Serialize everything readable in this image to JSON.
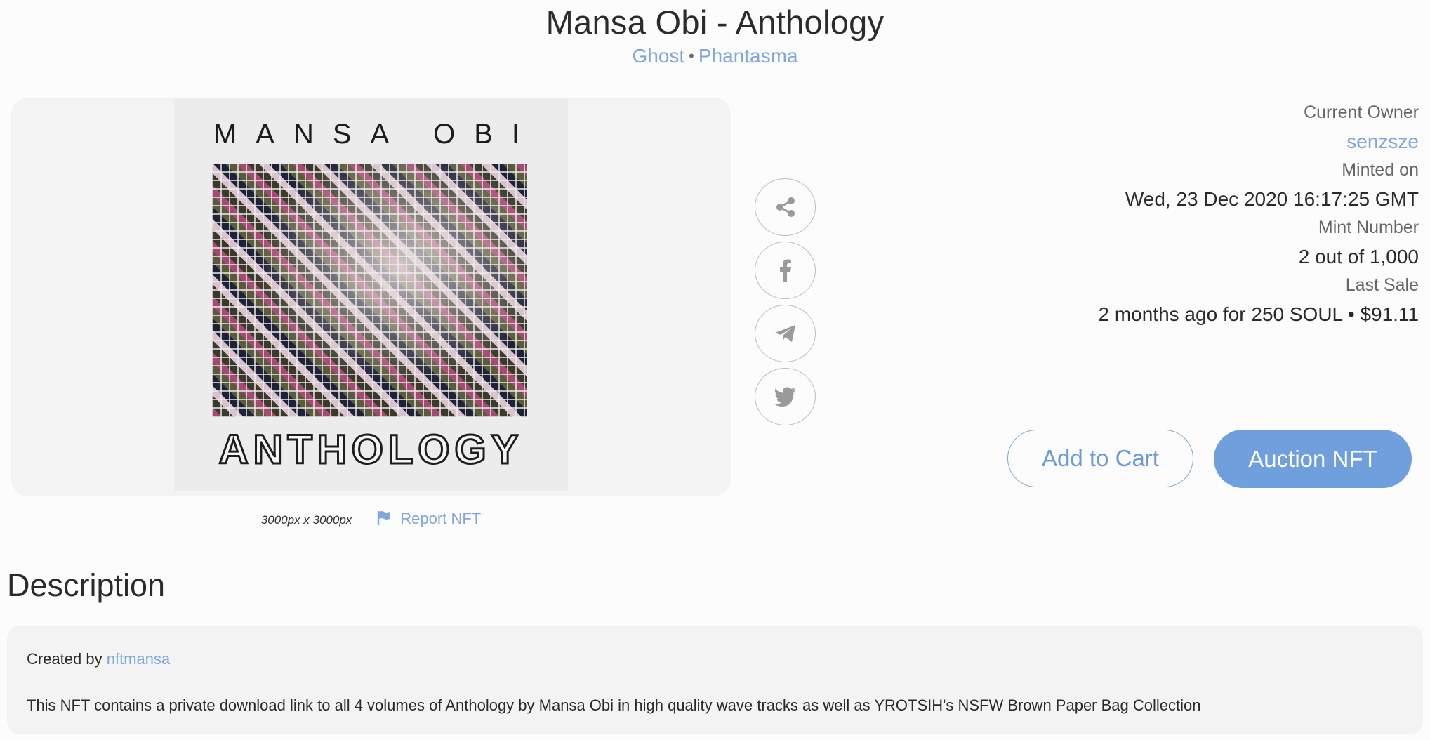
{
  "header": {
    "title": "Mansa Obi - Anthology",
    "links": [
      "Ghost",
      "Phantasma"
    ],
    "separator": "•"
  },
  "artwork": {
    "top_text": "MANSA OBI",
    "bottom_text": "ANTHOLOGY",
    "dimensions": "3000px x 3000px",
    "report_label": "Report NFT"
  },
  "share": {
    "icons": [
      "share-icon",
      "facebook-icon",
      "telegram-icon",
      "twitter-icon"
    ]
  },
  "info": {
    "owner_label": "Current Owner",
    "owner_value": "senzsze",
    "minted_label": "Minted on",
    "minted_value": "Wed, 23 Dec 2020 16:17:25 GMT",
    "mint_number_label": "Mint Number",
    "mint_number_value": "2 out of 1,000",
    "last_sale_label": "Last Sale",
    "last_sale_value": "2 months ago for 250 SOUL • $91.11"
  },
  "actions": {
    "add_to_cart": "Add to Cart",
    "auction": "Auction NFT"
  },
  "description": {
    "heading": "Description",
    "created_by_label": "Created by",
    "creator": "nftmansa",
    "text": "This NFT contains a private download link to all 4 volumes of Anthology by Mansa Obi in high quality wave tracks as well as YROTSIH's NSFW Brown Paper Bag Collection"
  },
  "colors": {
    "accent": "#7fa7da",
    "primary_button": "#6f9fdc",
    "panel": "#f3f3f3"
  }
}
